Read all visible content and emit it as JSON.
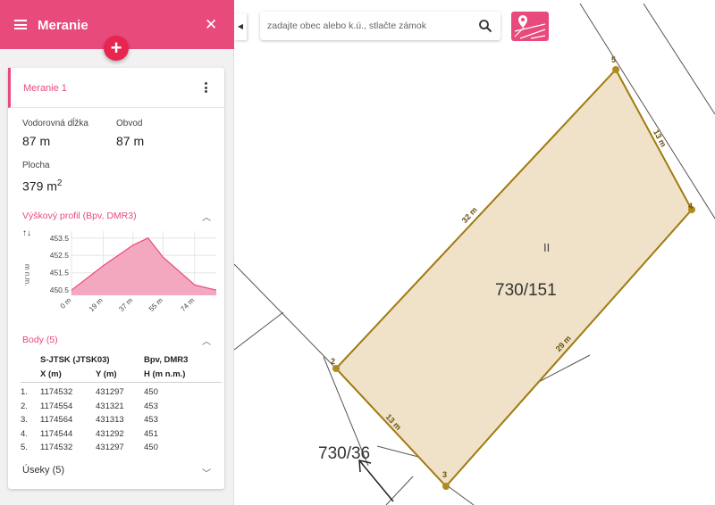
{
  "header": {
    "title": "Meranie",
    "add_label": "+",
    "close_label": "✕"
  },
  "measurement": {
    "name": "Meranie 1",
    "length_label": "Vodorovná dĺžka",
    "length_value": "87 m",
    "perimeter_label": "Obvod",
    "perimeter_value": "87 m",
    "area_label": "Plocha",
    "area_value": "379 m",
    "area_unit_exp": "2"
  },
  "profile": {
    "title": "Výškový profil (Bpv, DMR3)",
    "axis_icon": "↑↓",
    "ylabel": "m n.m.",
    "chevron": "︿"
  },
  "chart_data": {
    "type": "area",
    "x": [
      0,
      19,
      37,
      46,
      55,
      74,
      87
    ],
    "y": [
      450.5,
      451.9,
      453.1,
      453.5,
      452.4,
      450.8,
      450.5
    ],
    "xticks": [
      "0 m",
      "19 m",
      "37 m",
      "55 m",
      "74 m"
    ],
    "xtick_values": [
      0,
      19,
      37,
      55,
      74
    ],
    "yticks": [
      450.5,
      451.5,
      452.5,
      453.5
    ],
    "ylim": [
      450.2,
      453.9
    ],
    "xlim": [
      0,
      87
    ],
    "ylabel": "m n.m.",
    "grid": true,
    "fill_color": "#f4a8c0",
    "line_color": "#e84a7c"
  },
  "points": {
    "title": "Body (5)",
    "chevron": "︿",
    "header_sys1": "S-JTSK (JTSK03)",
    "header_sys2": "Bpv, DMR3",
    "col_x": "X (m)",
    "col_y": "Y (m)",
    "col_h": "H (m n.m.)",
    "rows": [
      {
        "n": "1.",
        "x": "1174532",
        "y": "431297",
        "h": "450"
      },
      {
        "n": "2.",
        "x": "1174554",
        "y": "431321",
        "h": "453"
      },
      {
        "n": "3.",
        "x": "1174564",
        "y": "431313",
        "h": "453"
      },
      {
        "n": "4.",
        "x": "1174544",
        "y": "431292",
        "h": "451"
      },
      {
        "n": "5.",
        "x": "1174532",
        "y": "431297",
        "h": "450"
      }
    ]
  },
  "segments": {
    "title": "Úseky (5)",
    "chevron": "﹀"
  },
  "search": {
    "placeholder": "zadajte obec alebo k.ú., stlačte zámok",
    "collapse_label": "◀"
  },
  "map": {
    "parcel_main": "730/151",
    "parcel_other": "730/36",
    "parcel_mark": "II",
    "vertex_labels": [
      "5",
      "4",
      "3",
      "2"
    ],
    "edge_labels": [
      "32 m",
      "13 m",
      "29 m",
      "13 m"
    ],
    "accent": "#a07a10",
    "fill": "#efe2c8"
  }
}
